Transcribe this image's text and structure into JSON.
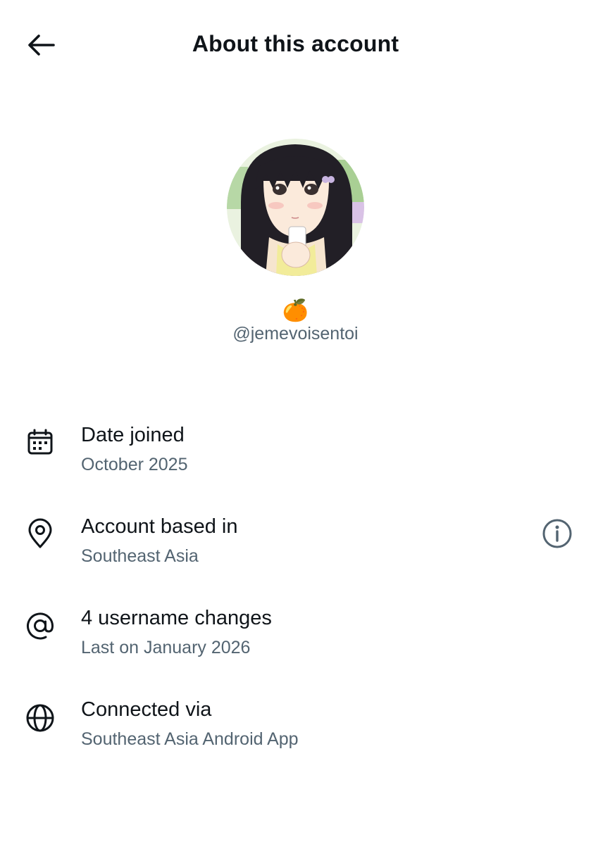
{
  "header": {
    "title": "About this account",
    "back_icon": "arrow-left-icon"
  },
  "profile": {
    "avatar_icon": "anime-girl-avatar",
    "emoji": "🍊",
    "handle": "@jemevoisentoi"
  },
  "rows": [
    {
      "icon": "calendar-icon",
      "title": "Date joined",
      "subtitle": "October 2025"
    },
    {
      "icon": "location-pin-icon",
      "title": "Account based in",
      "subtitle": "Southeast Asia",
      "action_icon": "info-icon"
    },
    {
      "icon": "at-sign-icon",
      "title": "4 username changes",
      "subtitle": "Last on January 2026"
    },
    {
      "icon": "globe-icon",
      "title": "Connected via",
      "subtitle": "Southeast Asia Android App"
    }
  ],
  "colors": {
    "primary_text": "#0f1419",
    "secondary_text": "#536471",
    "background": "#ffffff"
  }
}
